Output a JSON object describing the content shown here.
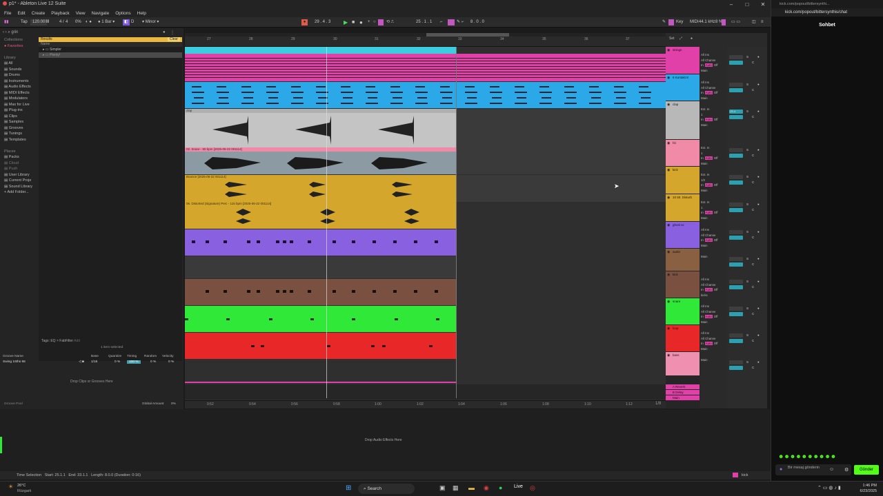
{
  "window": {
    "title": "p1* - Ableton Live 12 Suite"
  },
  "menu": [
    "File",
    "Edit",
    "Create",
    "Playback",
    "View",
    "Navigate",
    "Options",
    "Help"
  ],
  "control_bar": {
    "tap": "Tap",
    "tempo": "120.00",
    "signature_a": "4",
    "signature_b": "4",
    "cpu": "0%",
    "quantize": "1 Bar",
    "key_mode": "D",
    "scale": "Minor",
    "position": "29 .  4 .  3",
    "loop_start": "25 .  1 .  1",
    "loop_length": "8 .  0 .  0",
    "key_label": "Key",
    "midi_label": "MIDI",
    "sample_rate": "44.1 kHz",
    "cpu_pct": "8 %"
  },
  "browser": {
    "search_value": "grin",
    "collections_label": "Collections",
    "favorites_label": "Favorites",
    "library_label": "Library",
    "library_items": [
      "All",
      "Sounds",
      "Drums",
      "Instruments",
      "Audio Effects",
      "MIDI Effects",
      "Modulators",
      "Max for Live",
      "Plug-ins",
      "Clips",
      "Samples",
      "Grooves",
      "Tunings",
      "Templates"
    ],
    "places_label": "Places",
    "places_items": [
      "Packs",
      "Cloud",
      "Push",
      "User Library",
      "Current Proje",
      "Sound Library",
      "Add Folder..."
    ],
    "results_label": "Results",
    "clear_label": "Clear",
    "name_col": "Name",
    "results": [
      "Simpler",
      "Plenty!"
    ],
    "tags_label": "Tags:",
    "tag_eq": "EQ",
    "tag_fabfilter": "FabFilter",
    "tag_add": "Add",
    "selected_info": "1 item selected"
  },
  "groove": {
    "cols": [
      "Groove Name",
      "Base",
      "Quantize",
      "Timing",
      "Random",
      "Velocity"
    ],
    "row": {
      "name": "Swing 16ths 66",
      "base": "1/16",
      "quantize": "0 %",
      "timing": "100 %",
      "random": "0 %",
      "velocity": "0 %"
    },
    "drop_text": "Drop Clips or Grooves Here",
    "pool_label": "Groove Pool",
    "global_label": "Global Amount",
    "global_value": "0%"
  },
  "ruler": {
    "bars": [
      "27",
      "28",
      "29",
      "30",
      "31",
      "32",
      "33",
      "34",
      "35",
      "36",
      "37"
    ],
    "times": [
      "0:52",
      "0:54",
      "0:56",
      "0:58",
      "1:00",
      "1:02",
      "1:04",
      "1:06",
      "1:08",
      "1:10",
      "1:12"
    ]
  },
  "clips": {
    "clap": "clap",
    "snare": "02. Snare - 80 bpm [2025-06-22 001114]",
    "bounce": "Bounce [2025-06-22 001114]",
    "distortion": "06. Distorted (Signature) Perc - 115 bpm [2025-06-22 001114]"
  },
  "tracks": [
    {
      "name": "strings",
      "color": "#e040a8"
    },
    {
      "name": "6 Kontakt 8",
      "color": "#2aa8e8"
    },
    {
      "name": "clap",
      "color": "#b8b8b8"
    },
    {
      "name": "hit",
      "color": "#f08aa6"
    },
    {
      "name": "kick",
      "color": "#d4a62c"
    },
    {
      "name": "10 60. Disturb",
      "color": "#d4a62c"
    },
    {
      "name": "ghost sc",
      "color": "#8860e0"
    },
    {
      "name": "audio",
      "color": "#8a6042"
    },
    {
      "name": "kick",
      "color": "#7a5040"
    },
    {
      "name": "snare",
      "color": "#30e838"
    },
    {
      "name": "loop",
      "color": "#e82828"
    },
    {
      "name": "bass",
      "color": "#f090b0"
    }
  ],
  "returns": [
    "A Reverb",
    "B Delay",
    "Main"
  ],
  "io": {
    "all_ins": "All Ins",
    "all_channels": "All Channe",
    "in": "In",
    "auto": "Auto",
    "off": "Off",
    "main": "Main",
    "ext_in": "Ext. In",
    "one": "1",
    "half": "1/2",
    "kicks": "kicks"
  },
  "mixer": {
    "s": "S",
    "c": "C",
    "vol_clap": "-25.4"
  },
  "lower": {
    "drop_audio": "Drop Audio Effects Here"
  },
  "status": {
    "time_selection": "Time Selection",
    "start": "Start: 25.1.1",
    "end": "End: 33.1.1",
    "length": "Length: 8.0.0 (Duration: 0:16)",
    "track_label": "kick"
  },
  "arrange_footer": {
    "zoom": "1/8"
  },
  "set_label": "Set",
  "chat": {
    "url": "kick.com/popout/bittersynthis/chat",
    "url_short": "kick.com/popout/bittersynthi...",
    "header": "Sohbet",
    "placeholder": "Bir mesaj gönderin",
    "send": "Gönder"
  },
  "taskbar": {
    "weather_temp": "26°C",
    "weather_desc": "Rüzgarlı",
    "search": "Search",
    "time": "1:46 PM",
    "date": "6/23/2025"
  }
}
